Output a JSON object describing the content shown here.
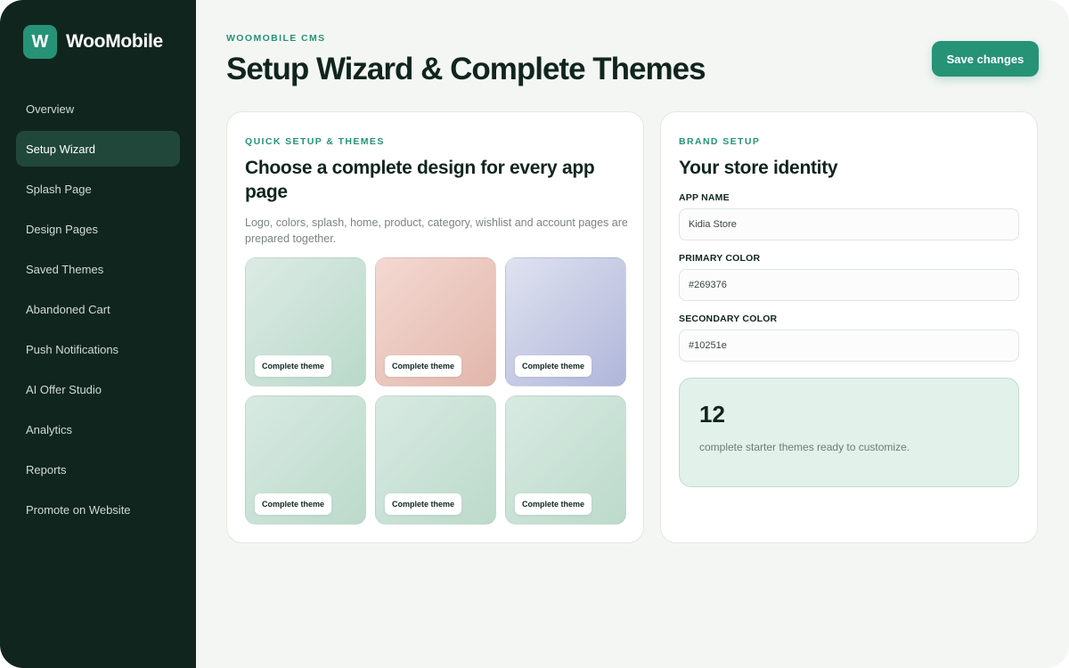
{
  "brand": {
    "logo_letter": "W",
    "name": "WooMobile"
  },
  "sidebar": {
    "items": [
      {
        "label": "Overview",
        "active": false
      },
      {
        "label": "Setup Wizard",
        "active": true
      },
      {
        "label": "Splash Page",
        "active": false
      },
      {
        "label": "Design Pages",
        "active": false
      },
      {
        "label": "Saved Themes",
        "active": false
      },
      {
        "label": "Abandoned Cart",
        "active": false
      },
      {
        "label": "Push Notifications",
        "active": false
      },
      {
        "label": "AI Offer Studio",
        "active": false
      },
      {
        "label": "Analytics",
        "active": false
      },
      {
        "label": "Reports",
        "active": false
      },
      {
        "label": "Promote on Website",
        "active": false
      }
    ]
  },
  "header": {
    "eyebrow": "WOOMOBILE CMS",
    "title": "Setup Wizard & Complete Themes",
    "save_label": "Save changes"
  },
  "themes_card": {
    "eyebrow": "QUICK SETUP & THEMES",
    "heading": "Choose a complete design for every app page",
    "description": "Logo, colors, splash, home, product, category, wishlist and account pages are prepared together.",
    "themes": [
      {
        "label": "Complete theme",
        "color_from": "#dcebe4",
        "color_to": "#b9d9ca"
      },
      {
        "label": "Complete theme",
        "color_from": "#f3d9d2",
        "color_to": "#e2b6ab"
      },
      {
        "label": "Complete theme",
        "color_from": "#dfe2f0",
        "color_to": "#b0b6da"
      },
      {
        "label": "Complete theme",
        "color_from": "#d8eae2",
        "color_to": "#bcdacb"
      },
      {
        "label": "Complete theme",
        "color_from": "#d8eae2",
        "color_to": "#bcdacb"
      },
      {
        "label": "Complete theme",
        "color_from": "#d8eae2",
        "color_to": "#bcdacb"
      }
    ]
  },
  "brand_card": {
    "eyebrow": "BRAND SETUP",
    "heading": "Your store identity",
    "app_name_label": "APP NAME",
    "app_name_value": "Kidia Store",
    "primary_color_label": "PRIMARY COLOR",
    "primary_color_value": "#269376",
    "secondary_color_label": "SECONDARY COLOR",
    "secondary_color_value": "#10251e",
    "stat_number": "12",
    "stat_text": "complete starter themes ready to customize."
  },
  "colors": {
    "accent": "#269376",
    "sidebar_bg": "#10251e",
    "sidebar_active": "#21473b",
    "page_bg": "#f4f6f4"
  }
}
